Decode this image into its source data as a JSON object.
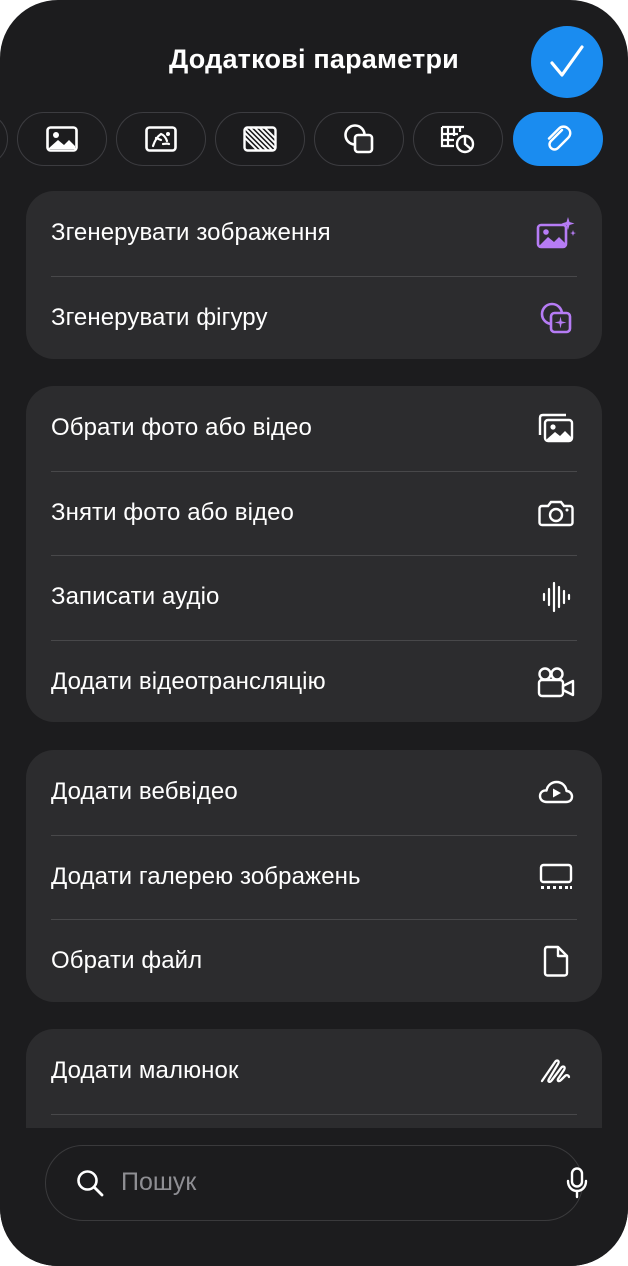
{
  "header": {
    "title": "Додаткові параметри"
  },
  "tabs": [
    {
      "id": "image",
      "icon": "image-icon",
      "active": false
    },
    {
      "id": "image-edit",
      "icon": "image-sparkle-icon",
      "active": false
    },
    {
      "id": "pattern",
      "icon": "hatch-pattern-icon",
      "active": false
    },
    {
      "id": "shapes",
      "icon": "shapes-icon",
      "active": false
    },
    {
      "id": "table-chart",
      "icon": "table-chart-icon",
      "active": false
    },
    {
      "id": "attachment",
      "icon": "paperclip-icon",
      "active": true
    }
  ],
  "groups": {
    "generate": {
      "items": [
        {
          "label": "Згенерувати зображення",
          "icon": "generate-image-icon"
        },
        {
          "label": "Згенерувати фігуру",
          "icon": "generate-shape-icon"
        }
      ]
    },
    "media": {
      "items": [
        {
          "label": "Обрати фото або відео",
          "icon": "photo-library-icon"
        },
        {
          "label": "Зняти фото або відео",
          "icon": "camera-icon"
        },
        {
          "label": "Записати аудіо",
          "icon": "waveform-icon"
        },
        {
          "label": "Додати відеотрансляцію",
          "icon": "video-camera-icon"
        }
      ]
    },
    "web": {
      "items": [
        {
          "label": "Додати вебвідео",
          "icon": "cloud-play-icon"
        },
        {
          "label": "Додати галерею зображень",
          "icon": "gallery-icon"
        },
        {
          "label": "Обрати файл",
          "icon": "document-icon"
        }
      ]
    },
    "drawing": {
      "items": [
        {
          "label": "Додати малюнок",
          "icon": "scribble-icon"
        }
      ]
    }
  },
  "search": {
    "placeholder": "Пошук"
  },
  "colors": {
    "accent": "#1a8cf0",
    "purple": "#b67cf5",
    "background": "#1c1c1e",
    "group": "#2c2c2e"
  }
}
